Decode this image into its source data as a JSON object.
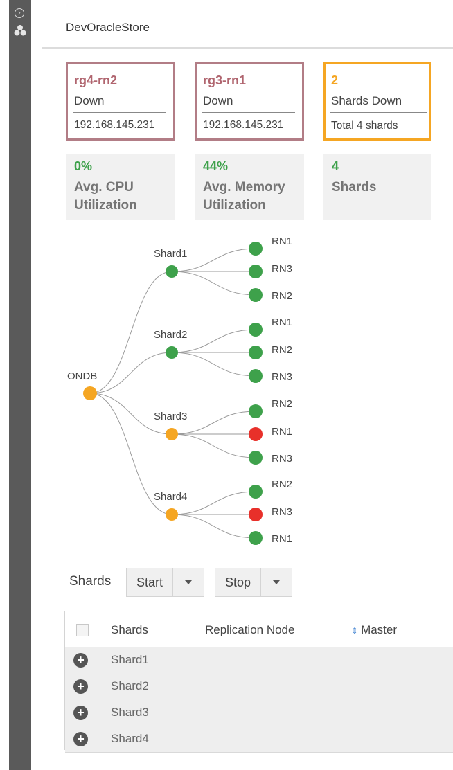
{
  "header": {
    "title": "DevOracleStore"
  },
  "sidebar": {
    "icons": [
      "expand-chevron-icon",
      "cluster-icon"
    ]
  },
  "alerts": [
    {
      "name": "rg4-rn2",
      "status": "Down",
      "ip": "192.168.145.231"
    },
    {
      "name": "rg3-rn1",
      "status": "Down",
      "ip": "192.168.145.231"
    }
  ],
  "shards_summary": {
    "count": "2",
    "label": "Shards Down",
    "total": "Total 4 shards"
  },
  "metrics": [
    {
      "value": "0%",
      "label_line1": "Avg. CPU",
      "label_line2": "Utilization"
    },
    {
      "value": "44%",
      "label_line1": "Avg. Memory",
      "label_line2": "Utilization"
    },
    {
      "value": "4",
      "label_line1": "Shards",
      "label_line2": ""
    }
  ],
  "topology": {
    "root": {
      "label": "ONDB",
      "status": "warning"
    },
    "shards": [
      {
        "label": "Shard1",
        "status": "ok",
        "nodes": [
          {
            "label": "RN1",
            "status": "ok"
          },
          {
            "label": "RN3",
            "status": "ok"
          },
          {
            "label": "RN2",
            "status": "ok"
          }
        ]
      },
      {
        "label": "Shard2",
        "status": "ok",
        "nodes": [
          {
            "label": "RN1",
            "status": "ok"
          },
          {
            "label": "RN2",
            "status": "ok"
          },
          {
            "label": "RN3",
            "status": "ok"
          }
        ]
      },
      {
        "label": "Shard3",
        "status": "warning",
        "nodes": [
          {
            "label": "RN2",
            "status": "ok"
          },
          {
            "label": "RN1",
            "status": "down"
          },
          {
            "label": "RN3",
            "status": "ok"
          }
        ]
      },
      {
        "label": "Shard4",
        "status": "warning",
        "nodes": [
          {
            "label": "RN2",
            "status": "ok"
          },
          {
            "label": "RN3",
            "status": "down"
          },
          {
            "label": "RN1",
            "status": "ok"
          }
        ]
      }
    ],
    "colors": {
      "ok": "#3ea14b",
      "warning": "#f5a623",
      "down": "#e8302a",
      "link": "#9a9a9a"
    }
  },
  "toolbar": {
    "label": "Shards",
    "start_label": "Start",
    "stop_label": "Stop"
  },
  "table": {
    "columns": [
      "Shards",
      "Replication Node",
      "Master"
    ],
    "rows": [
      "Shard1",
      "Shard2",
      "Shard3",
      "Shard4"
    ]
  }
}
